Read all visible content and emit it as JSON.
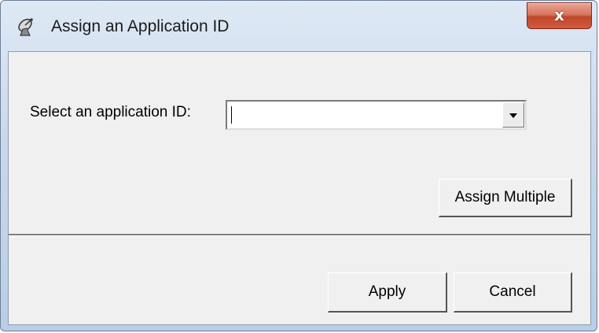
{
  "window": {
    "title": "Assign an Application ID",
    "app_icon": "satellite-dish-icon",
    "close_icon": "close-icon",
    "close_glyph": "x"
  },
  "form": {
    "select_label": "Select an application ID:",
    "application_id": {
      "value": "",
      "options_visible": false
    },
    "dropdown_icon": "chevron-down-icon"
  },
  "buttons": {
    "assign_multiple": "Assign Multiple",
    "apply": "Apply",
    "cancel": "Cancel"
  },
  "colors": {
    "close_button": "#c1472b",
    "dialog_background": "#f0f0f0",
    "title_bar": "#c9d9ec"
  }
}
